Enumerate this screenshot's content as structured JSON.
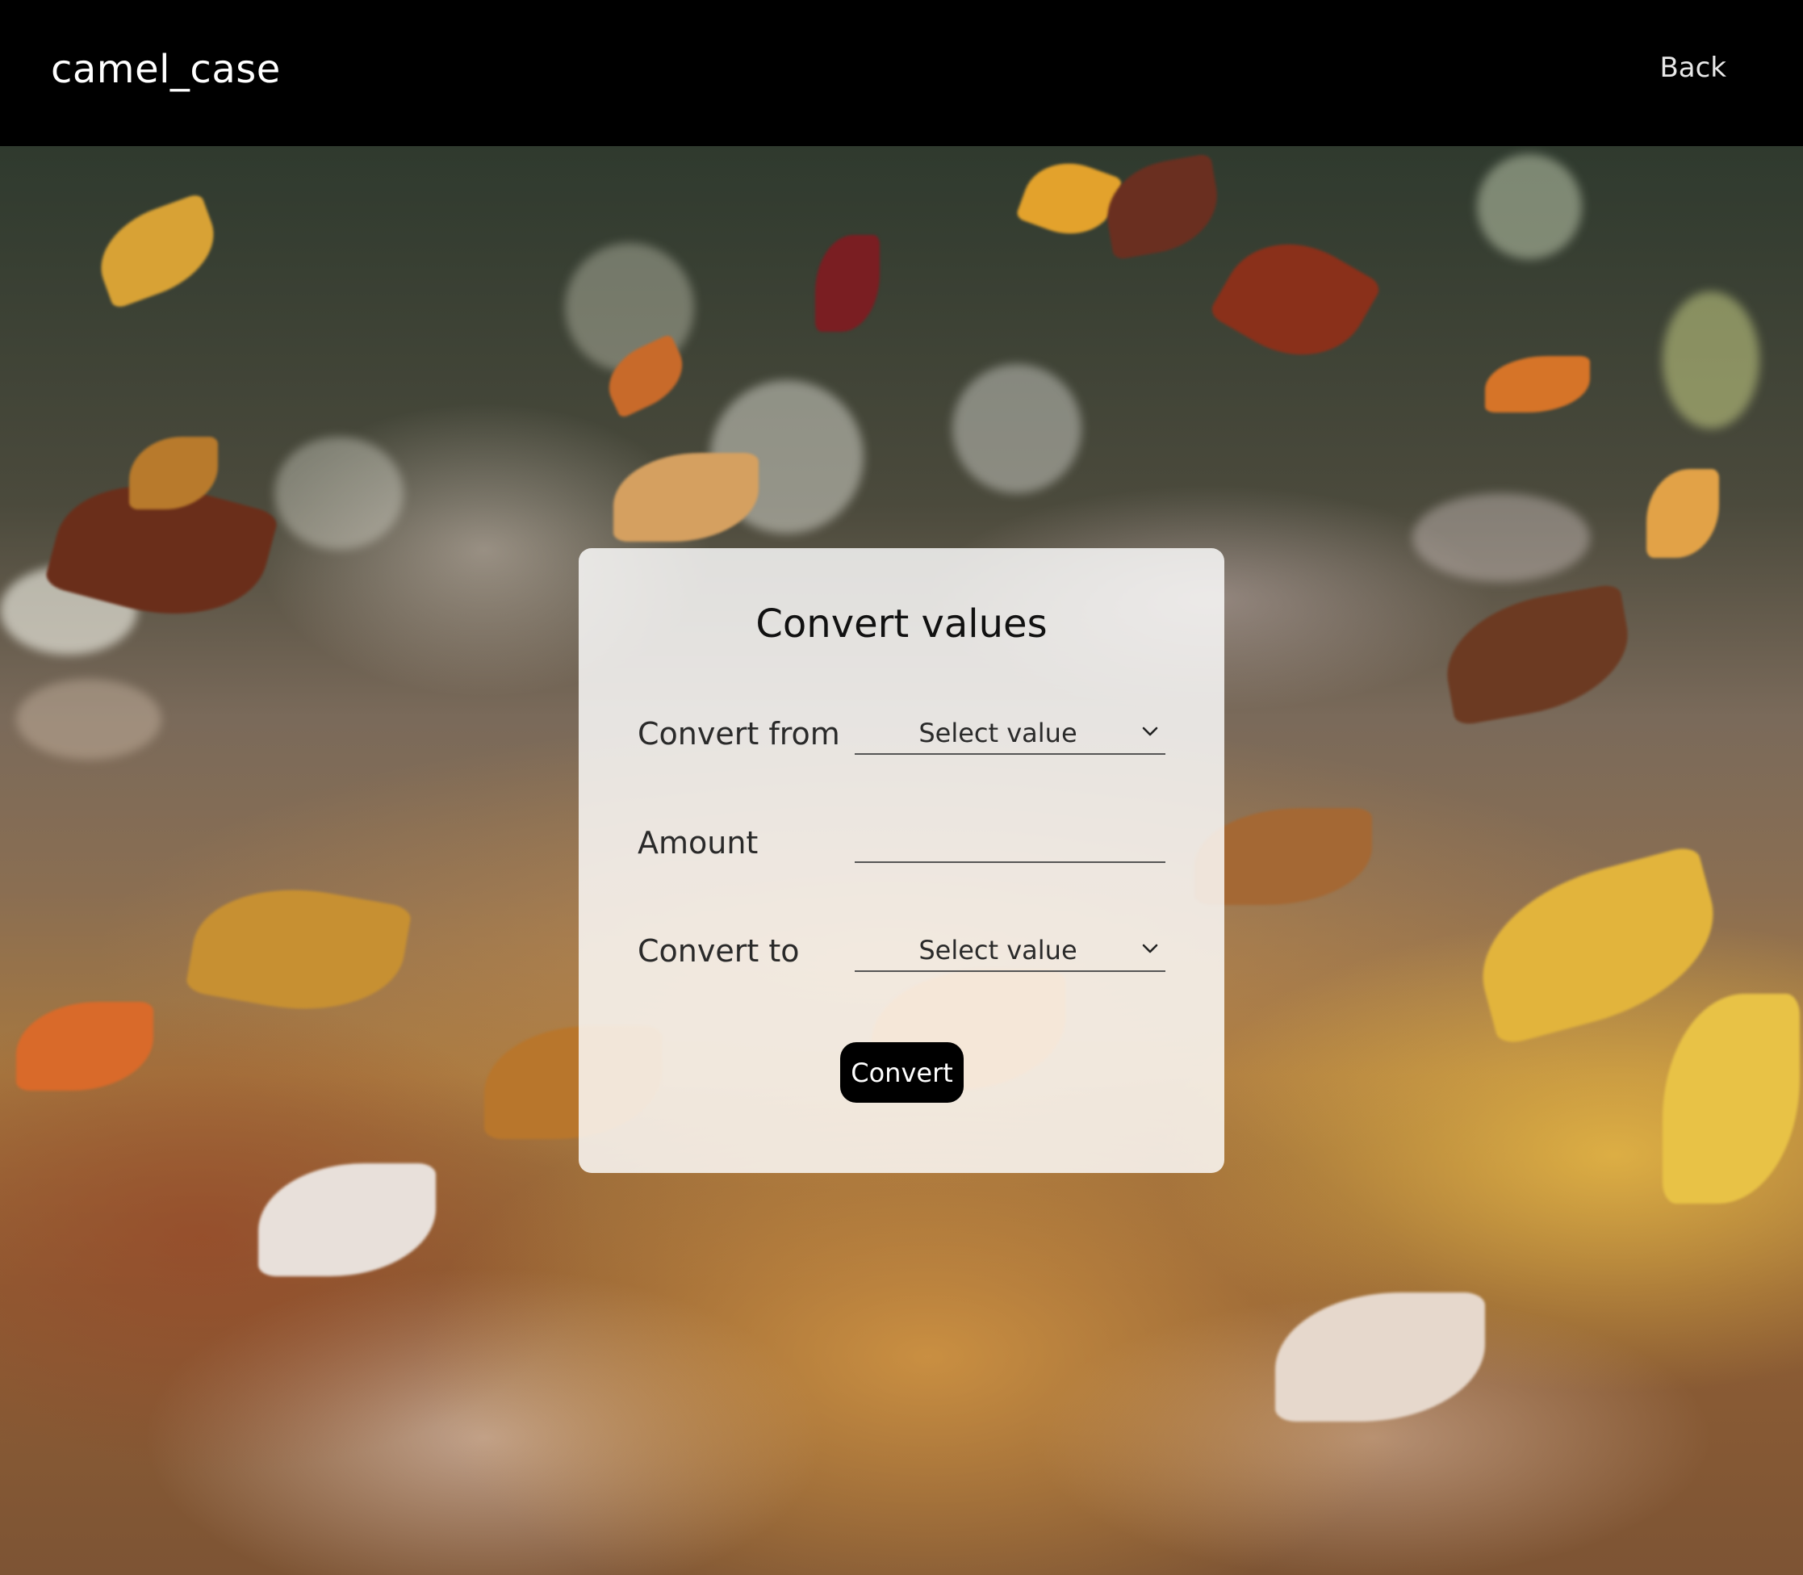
{
  "header": {
    "brand": "camel_case",
    "back_label": "Back"
  },
  "card": {
    "title": "Convert values",
    "convert_from": {
      "label": "Convert from",
      "selected": "Select value"
    },
    "amount": {
      "label": "Amount",
      "value": ""
    },
    "convert_to": {
      "label": "Convert to",
      "selected": "Select value"
    },
    "submit_label": "Convert"
  },
  "icons": {
    "dropdown": "chevron-down-icon"
  },
  "colors": {
    "header_bg": "#000000",
    "button_bg": "#000000",
    "card_bg": "rgba(255,255,255,0.82)"
  }
}
